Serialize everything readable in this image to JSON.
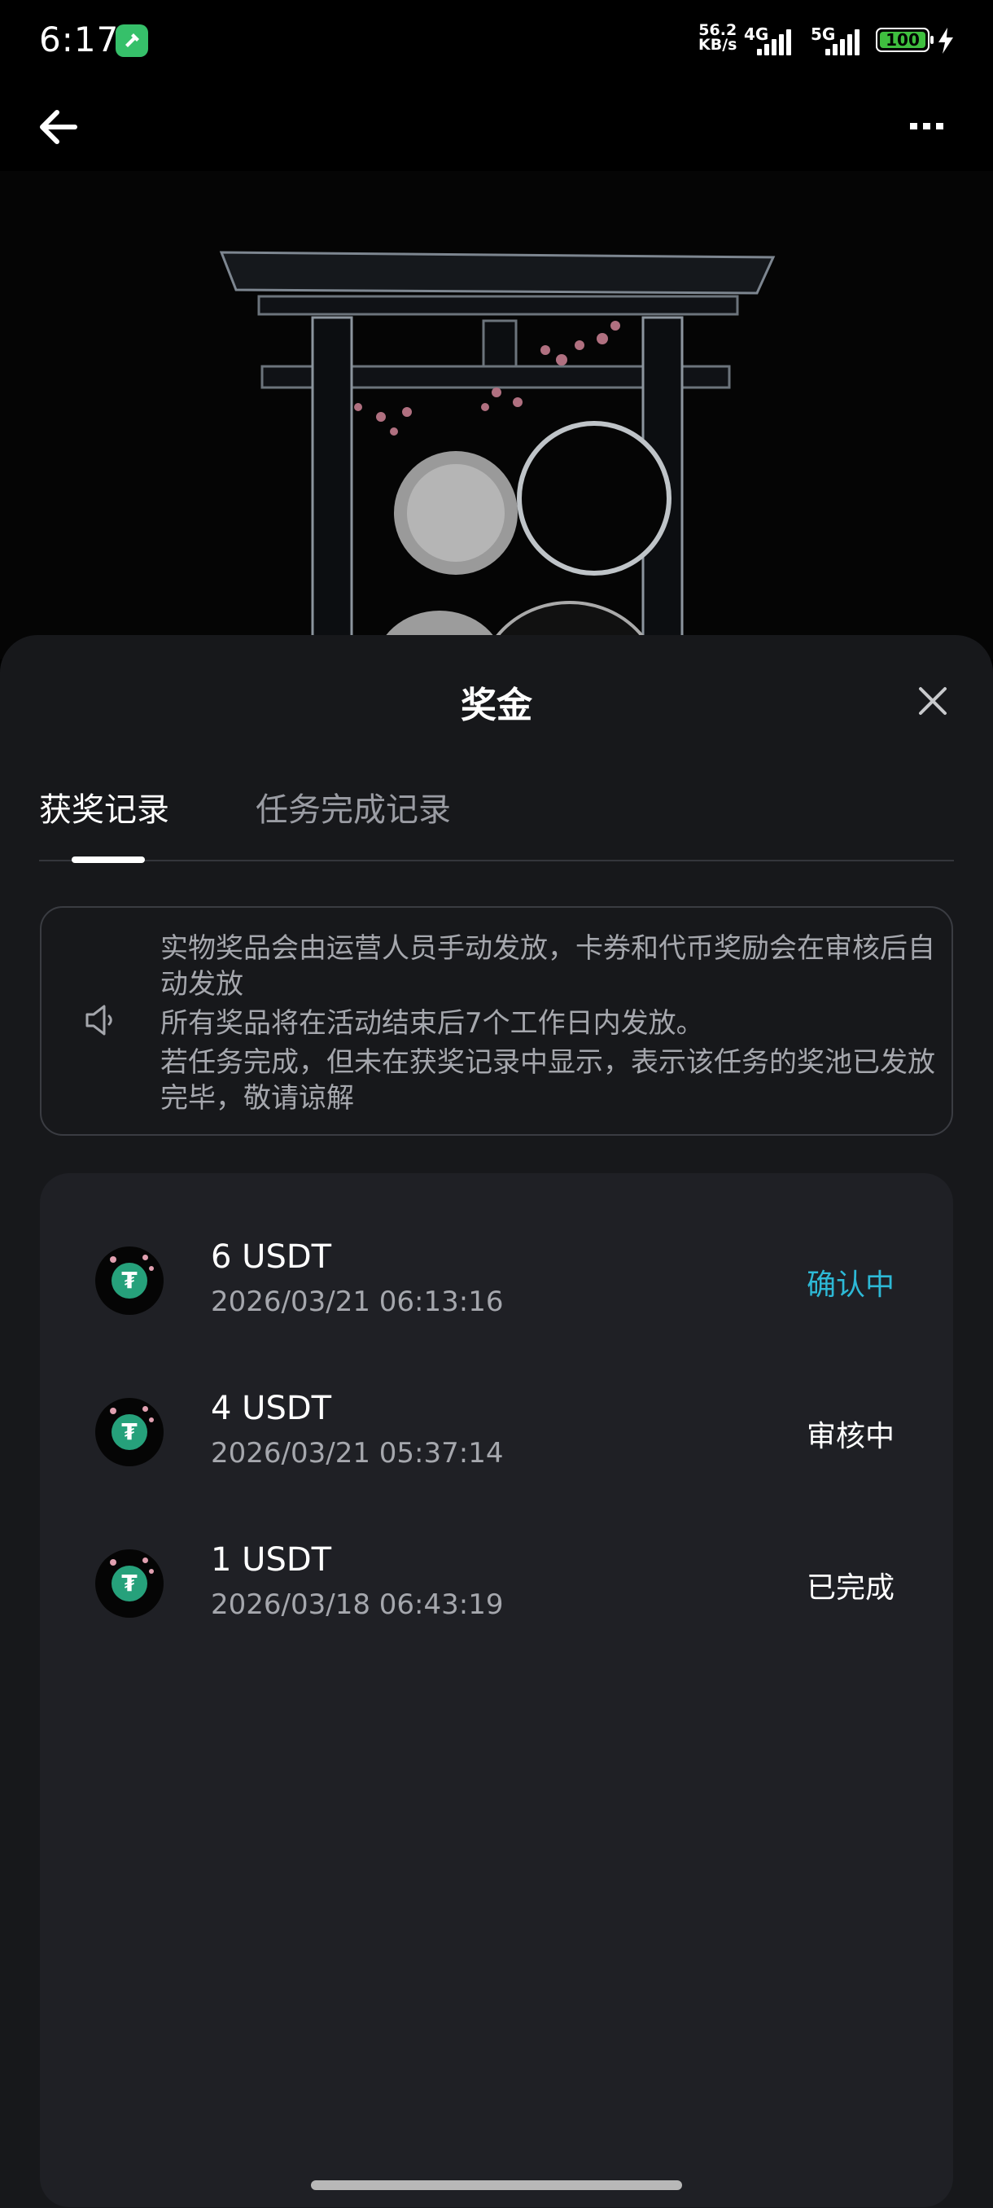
{
  "status_bar": {
    "time": "6:17",
    "net_speed_value": "56.2",
    "net_speed_unit": "KB/s",
    "signal_1_label": "4G",
    "signal_2_label": "5G",
    "battery": "100"
  },
  "header": {
    "back_icon": "arrow-left-icon",
    "more_icon": "more-horizontal-icon"
  },
  "sheet": {
    "title": "奖金",
    "close_icon": "close-icon",
    "tabs": [
      {
        "label": "获奖记录",
        "active": true
      },
      {
        "label": "任务完成记录",
        "active": false
      }
    ],
    "notice": {
      "icon": "speaker-icon",
      "lines": [
        "实物奖品会由运营人员手动发放，卡券和代币奖励会在审核后自动发放",
        "所有奖品将在活动结束后7个工作日内发放。",
        "若任务完成，但未在获奖记录中显示，表示该任务的奖池已发放完毕，敬请谅解"
      ]
    },
    "records": [
      {
        "amount": "6 USDT",
        "datetime": "2026/03/21 06:13:16",
        "status": "确认中",
        "status_color": "#2db9d6"
      },
      {
        "amount": "4 USDT",
        "datetime": "2026/03/21 05:37:14",
        "status": "审核中",
        "status_color": "#ffffff"
      },
      {
        "amount": "1 USDT",
        "datetime": "2026/03/18 06:43:19",
        "status": "已完成",
        "status_color": "#ffffff"
      }
    ]
  },
  "colors": {
    "sheet_bg": "#17181b",
    "card_bg": "#1f2025",
    "accent_cyan": "#2db9d6",
    "usdt_green": "#26a17b"
  }
}
